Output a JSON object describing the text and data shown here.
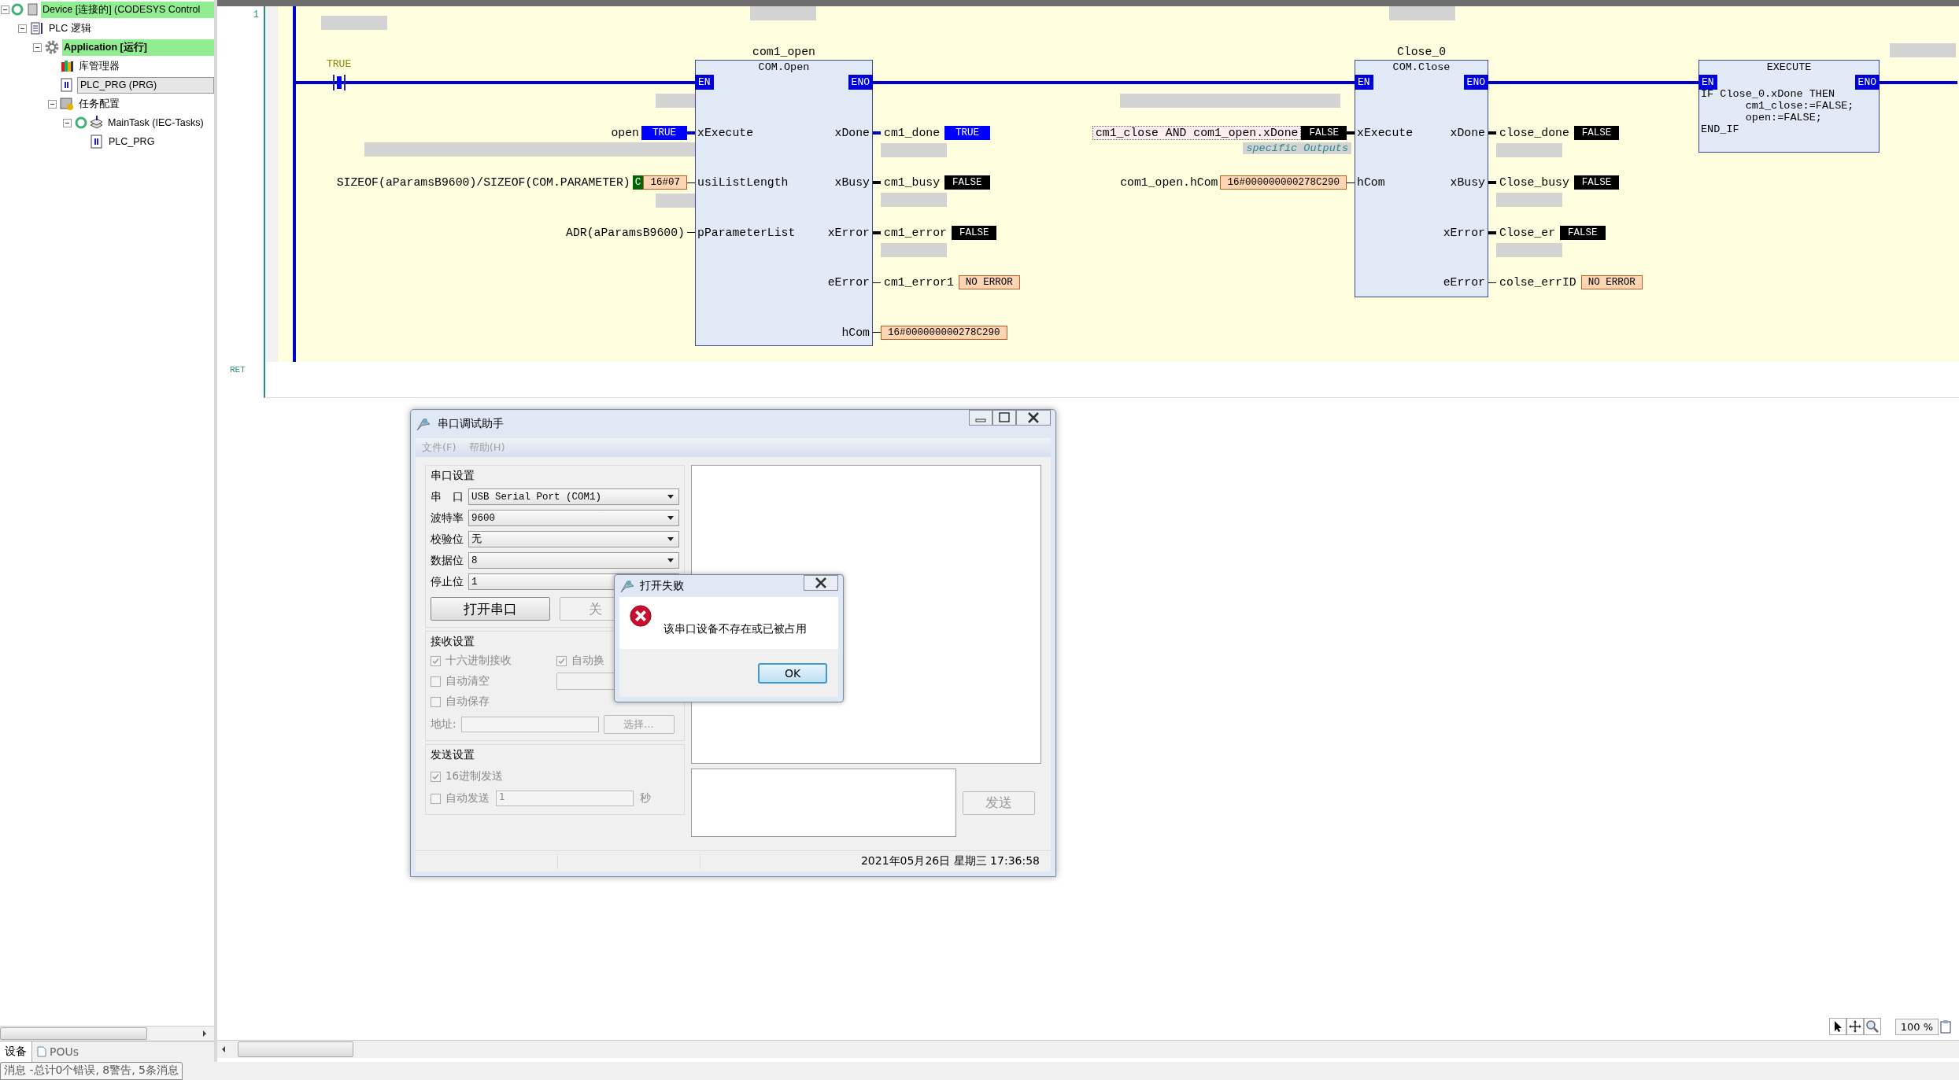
{
  "project_tree": {
    "items": [
      {
        "label": "Device [连接的] (CODESYS Control",
        "kind": "device",
        "expanded": true,
        "highlighted": true,
        "selected": false,
        "children": [
          {
            "label": "PLC 逻辑",
            "kind": "logic",
            "expanded": true,
            "highlighted": false,
            "selected": false,
            "children": [
              {
                "label": "Application [运行]",
                "kind": "application",
                "expanded": true,
                "highlighted": true,
                "selected": false,
                "children": [
                  {
                    "label": "库管理器",
                    "kind": "library",
                    "highlighted": false,
                    "selected": false
                  },
                  {
                    "label": "PLC_PRG (PRG)",
                    "kind": "program",
                    "highlighted": false,
                    "selected": true
                  },
                  {
                    "label": "任务配置",
                    "kind": "task_config",
                    "expanded": true,
                    "highlighted": false,
                    "selected": false,
                    "children": [
                      {
                        "label": "MainTask (IEC-Tasks)",
                        "kind": "task",
                        "expanded": true,
                        "highlighted": false,
                        "selected": false,
                        "children": [
                          {
                            "label": "PLC_PRG",
                            "kind": "program_call",
                            "highlighted": false,
                            "selected": false
                          }
                        ]
                      }
                    ]
                  }
                ]
              }
            ]
          }
        ]
      }
    ]
  },
  "left_tabs": [
    {
      "label": "设备",
      "selected": true
    },
    {
      "label": "POUs",
      "selected": false
    }
  ],
  "message_bar": "消息 -总计0个错误, 8警告, 5条消息",
  "ladder": {
    "network_number": "1",
    "contact_label": "TRUE",
    "return_label": "RET",
    "blocks": [
      {
        "kind": "function_block",
        "instance": "com1_open",
        "type": "COM.Open",
        "inputs": [
          {
            "pin": "EN",
            "kind": "en"
          },
          {
            "pin": "xExecute",
            "kind": "pin",
            "expr": "open",
            "value": {
              "text": "TRUE",
              "kind": "on"
            }
          },
          {
            "pin": "usiListLength",
            "kind": "pin",
            "expr": "SIZEOF(aParamsB9600)/SIZEOF(COM.PARAMETER)",
            "constant_marker": "C",
            "value": {
              "text": "16#07",
              "kind": "data"
            }
          },
          {
            "pin": "pParameterList",
            "kind": "pin",
            "expr": "ADR(aParamsB9600)"
          }
        ],
        "outputs": [
          {
            "pin": "ENO",
            "kind": "en"
          },
          {
            "pin": "xDone",
            "kind": "pin",
            "var": "cm1_done",
            "value": {
              "text": "TRUE",
              "kind": "on"
            }
          },
          {
            "pin": "xBusy",
            "kind": "pin",
            "var": "cm1_busy",
            "value": {
              "text": "FALSE",
              "kind": "off"
            }
          },
          {
            "pin": "xError",
            "kind": "pin",
            "var": "cm1_error",
            "value": {
              "text": "FALSE",
              "kind": "off"
            }
          },
          {
            "pin": "eError",
            "kind": "pin",
            "var": "cm1_error1",
            "value": {
              "text": "NO ERROR",
              "kind": "data"
            }
          },
          {
            "pin": "hCom",
            "kind": "pin",
            "value": {
              "text": "16#000000000278C290",
              "kind": "data"
            }
          }
        ]
      },
      {
        "kind": "function_block",
        "instance": "Close_0",
        "type": "COM.Close",
        "inputs": [
          {
            "pin": "EN",
            "kind": "en"
          },
          {
            "pin": "xExecute",
            "kind": "pin",
            "expr": "cm1_close AND com1_open.xDone",
            "expr_boxed": true,
            "value": {
              "text": "FALSE",
              "kind": "off"
            },
            "comment": "specific Outputs"
          },
          {
            "pin": "hCom",
            "kind": "pin",
            "expr": "com1_open.hCom",
            "value": {
              "text": "16#000000000278C290",
              "kind": "data"
            }
          }
        ],
        "outputs": [
          {
            "pin": "ENO",
            "kind": "en"
          },
          {
            "pin": "xDone",
            "kind": "pin",
            "var": "close_done",
            "value": {
              "text": "FALSE",
              "kind": "off"
            }
          },
          {
            "pin": "xBusy",
            "kind": "pin",
            "var": "Close_busy",
            "value": {
              "text": "FALSE",
              "kind": "off"
            }
          },
          {
            "pin": "xError",
            "kind": "pin",
            "var": "Close_er",
            "value": {
              "text": "FALSE",
              "kind": "off"
            }
          },
          {
            "pin": "eError",
            "kind": "pin",
            "var": "colse_errID",
            "value": {
              "text": "NO ERROR",
              "kind": "data"
            }
          }
        ]
      },
      {
        "kind": "st_block",
        "type": "EXECUTE",
        "inputs": [
          {
            "pin": "EN",
            "kind": "en"
          }
        ],
        "outputs": [
          {
            "pin": "ENO",
            "kind": "en"
          }
        ],
        "code": [
          "IF Close_0.xDone THEN",
          "       cm1_close:=FALSE;",
          "       open:=FALSE;",
          "END_IF"
        ]
      }
    ]
  },
  "zoom_level": "100 %",
  "serial_window": {
    "title": "串口调试助手",
    "menu": [
      {
        "label": "文件(F)",
        "disabled": true
      },
      {
        "label": "帮助(H)",
        "disabled": true
      }
    ],
    "port_settings": {
      "title": "串口设置",
      "fields": [
        {
          "label": "串　口",
          "value": "USB Serial Port (COM1)"
        },
        {
          "label": "波特率",
          "value": "9600"
        },
        {
          "label": "校验位",
          "value": "无"
        },
        {
          "label": "数据位",
          "value": "8"
        },
        {
          "label": "停止位",
          "value": "1"
        }
      ],
      "open_button": "打开串口",
      "close_button": "关"
    },
    "receive_settings": {
      "title": "接收设置",
      "options": [
        {
          "label": "十六进制接收",
          "checked": true
        },
        {
          "label": "自动换",
          "checked": true
        },
        {
          "label": "自动清空",
          "checked": false
        },
        {
          "label": "自动保存",
          "checked": false
        }
      ],
      "address_label": "地址:",
      "browse_button": "选择..."
    },
    "send_settings": {
      "title": "发送设置",
      "options": [
        {
          "label": "16进制发送",
          "checked": true
        },
        {
          "label": "自动发送",
          "checked": false
        }
      ],
      "interval_value": "1",
      "interval_unit": "秒"
    },
    "send_button": "发送",
    "status_time": "2021年05月26日 星期三 17:36:58"
  },
  "error_dialog": {
    "title": "打开失败",
    "message": "该串口设备不存在或已被占用",
    "ok_button": "OK"
  }
}
